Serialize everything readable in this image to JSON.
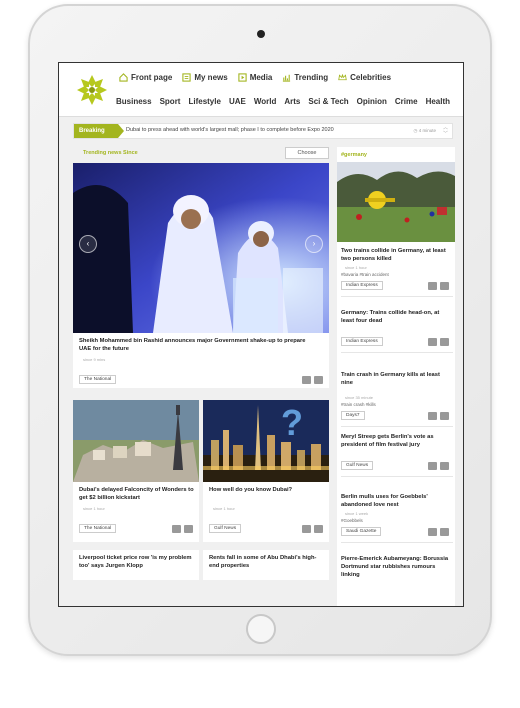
{
  "topnav": [
    {
      "label": "Front page",
      "icon": "home-icon"
    },
    {
      "label": "My news",
      "icon": "news-icon"
    },
    {
      "label": "Media",
      "icon": "play-icon"
    },
    {
      "label": "Trending",
      "icon": "chart-icon"
    },
    {
      "label": "Celebrities",
      "icon": "crown-icon"
    }
  ],
  "categories": [
    "Business",
    "Sport",
    "Lifestyle",
    "UAE",
    "World",
    "Arts",
    "Sci & Tech",
    "Opinion",
    "Crime",
    "Health"
  ],
  "breaking": {
    "label": "Breaking",
    "text": "Dubai to press ahead with world's largest mall; phase I to complete before Expo 2020",
    "time": "4 minute"
  },
  "trending": {
    "label": "Trending news Since",
    "choose": "Choose"
  },
  "hero": {
    "caption": "Sheikh Mohammed bin Rashid announces major Government shake-up to prepare UAE for the future",
    "meta": "since 9 mins",
    "source": "The National"
  },
  "cards": [
    {
      "title": "Dubai's delayed Falconcity of Wonders to get $2 billion kickstart",
      "meta": "since 1 hour",
      "source": "The National"
    },
    {
      "title": "How well do you know Dubai?",
      "meta": "since 1 hour",
      "source": "Gulf News"
    }
  ],
  "minis": [
    {
      "title": "Liverpool ticket price row 'is my problem too' says Jurgen Klopp"
    },
    {
      "title": "Rents fall in some of Abu Dhabi's high-end properties"
    }
  ],
  "right": {
    "tag": "#germany",
    "items": [
      {
        "title": "Two trains collide in Germany, at least two persons killed",
        "meta": "since 1 hour",
        "tags": "#bavaria  #train accident",
        "source": "Indian Express"
      },
      {
        "title": "Germany: Trains collide head-on, at least four dead",
        "meta": "",
        "tags": "",
        "source": "Indian Express"
      },
      {
        "title": "Train crash in Germany kills at least nine",
        "meta": "since 35 minute",
        "tags": "#train crash  #kills",
        "source": "Days7"
      },
      {
        "title": "Meryl Streep gets Berlin's vote as president of film festival jury",
        "meta": "",
        "tags": "",
        "source": "Gulf News"
      },
      {
        "title": "Berlin mulls uses for Goebbels' abandoned love nest",
        "meta": "since 1 week",
        "tags": "#Goebbels",
        "source": "Saudi Gazette"
      },
      {
        "title": "Pierre-Emerick Aubameyang: Borussia Dortmund star rubbishes rumours linking",
        "meta": "",
        "tags": "",
        "source": ""
      }
    ]
  }
}
